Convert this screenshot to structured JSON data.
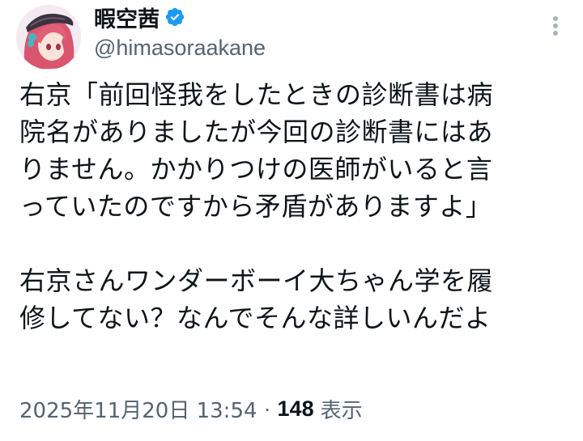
{
  "author": {
    "display_name": "暇空茜",
    "handle": "@himasoraakane",
    "verified": true,
    "verified_color": "#1d9bf0"
  },
  "tweet": {
    "lines": [
      "右京「前回怪我をしたときの診断書は病",
      "院名がありましたが今回の診断書にはあ",
      "りません。かかりつけの医師がいると言",
      "っていたのですから矛盾がありますよ」",
      "",
      "右京さんワンダーボーイ大ちゃん学を履",
      "修してない？なんでそんな詳しいんだよ"
    ]
  },
  "meta": {
    "datetime": "2025年11月20日 13:54",
    "separator": "·",
    "views_count": "148",
    "views_label": "表示"
  },
  "icons": {
    "more": "more-vertical-icon",
    "verified": "verified-badge-icon"
  },
  "colors": {
    "text_primary": "#0f1419",
    "text_secondary": "#536471",
    "accent": "#1d9bf0"
  }
}
